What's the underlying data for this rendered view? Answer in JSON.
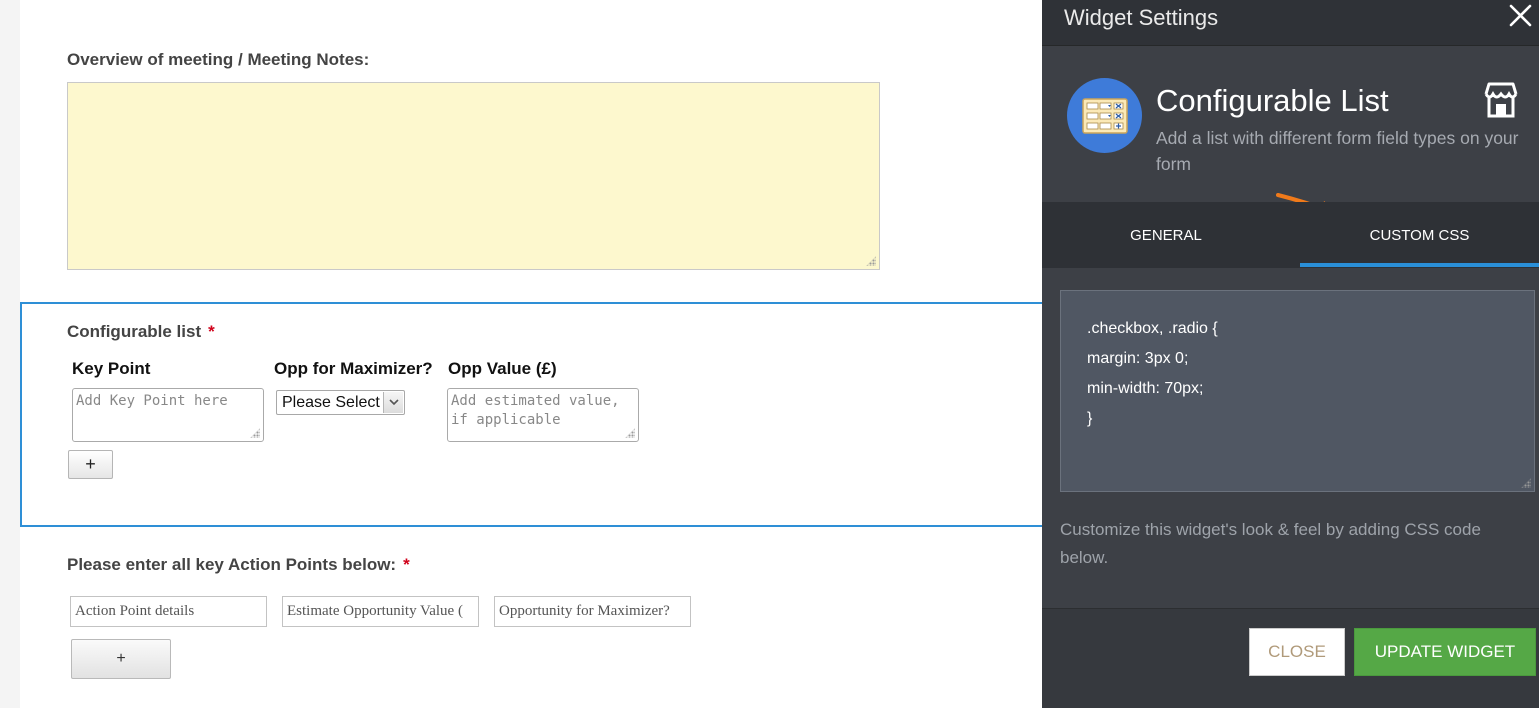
{
  "form": {
    "notes_label": "Overview of meeting / Meeting Notes:",
    "config_list": {
      "label": "Configurable list",
      "required_mark": "*",
      "columns": [
        "Key Point",
        "Opp for Maximizer?",
        "Opp Value (£)"
      ],
      "key_point_placeholder": "Add Key Point here",
      "select_value": "Please Select",
      "opp_value_placeholder": "Add estimated value, if applicable",
      "add_button": "+"
    },
    "action_points": {
      "label": "Please enter all key Action Points below:",
      "required_mark": "*",
      "inputs": [
        "Action Point details",
        "Estimate Opportunity Value (",
        "Opportunity for Maximizer?"
      ],
      "add_button": "+"
    }
  },
  "panel": {
    "title": "Widget Settings",
    "widget_name": "Configurable List",
    "widget_description": "Add a list with different form field types on your form",
    "tabs": [
      {
        "label": "GENERAL",
        "active": false
      },
      {
        "label": "CUSTOM CSS",
        "active": true
      }
    ],
    "css_code": [
      ".checkbox, .radio {",
      "margin: 3px 0;",
      "min-width: 70px;",
      "}"
    ],
    "help_text": "Customize this widget's look & feel by adding CSS code below.",
    "close_button": "CLOSE",
    "update_button": "UPDATE WIDGET"
  },
  "colors": {
    "accent_blue": "#2e8fd6",
    "update_green": "#55a846",
    "notes_bg": "#fdf8ce",
    "panel_bg": "#3d4046",
    "arrow_orange": "#f07a1a"
  },
  "icons": [
    "close-icon",
    "configurable-list-icon",
    "store-icon",
    "orange-arrow-icon",
    "select-arrow-icon",
    "resize-grip-icon"
  ]
}
